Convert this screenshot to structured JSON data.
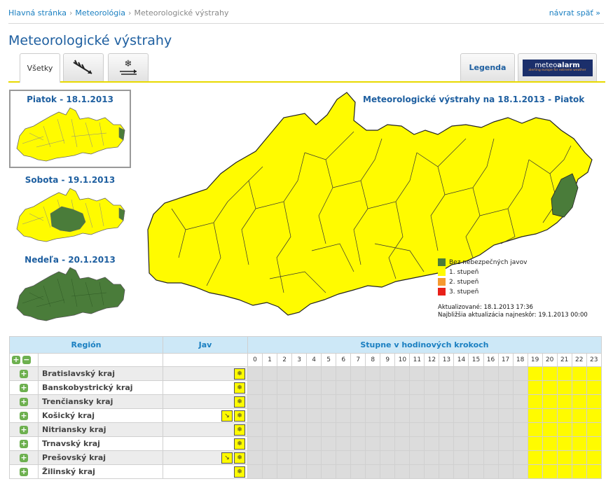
{
  "breadcrumb": {
    "home": "Hlavná stránka",
    "meteo": "Meteorológia",
    "current": "Meteorologické výstrahy"
  },
  "back_link": "návrat späť",
  "page_title": "Meteorologické výstrahy",
  "tabs": {
    "all": "Všetky",
    "legend": "Legenda",
    "meteoalarm_brand": "meteoalarm",
    "meteoalarm_prefix": "meteo",
    "meteoalarm_suffix": "alarm",
    "meteoalarm_tagline": "alerting europe for extreme weather"
  },
  "days": [
    {
      "label": "Piatok - 18.1.2013"
    },
    {
      "label": "Sobota - 19.1.2013"
    },
    {
      "label": "Nedeľa - 20.1.2013"
    }
  ],
  "map_title": "Meteorologické výstrahy na 18.1.2013 - Piatok",
  "legend": [
    {
      "label": "Bez nebezpečných javov",
      "color": "#4a7c3a"
    },
    {
      "label": "1. stupeň",
      "color": "#fffb00"
    },
    {
      "label": "2. stupeň",
      "color": "#f59a30"
    },
    {
      "label": "3. stupeň",
      "color": "#e8201a"
    }
  ],
  "updated": "Aktualizované: 18.1.2013 17:36",
  "next_update": "Najbližšia aktualizácia najneskôr: 19.1.2013 00:00",
  "colors": {
    "accent": "#1e5fa0",
    "yellow": "#fffb00",
    "green": "#4a7c3a"
  },
  "table": {
    "col_region": "Región",
    "col_phen": "Jav",
    "col_hours": "Stupne v hodinových krokoch",
    "hours": [
      "0",
      "1",
      "2",
      "3",
      "4",
      "5",
      "6",
      "7",
      "8",
      "9",
      "10",
      "11",
      "12",
      "13",
      "14",
      "15",
      "16",
      "17",
      "18",
      "19",
      "20",
      "21",
      "22",
      "23"
    ],
    "warn_from_hour": 19,
    "rows": [
      {
        "region": "Bratislavský kraj",
        "icons": [
          "snow-icon"
        ]
      },
      {
        "region": "Banskobystrický kraj",
        "icons": [
          "snow-icon"
        ]
      },
      {
        "region": "Trenčiansky kraj",
        "icons": [
          "snow-icon"
        ]
      },
      {
        "region": "Košický kraj",
        "icons": [
          "wind-icon",
          "snow-icon"
        ]
      },
      {
        "region": "Nitriansky kraj",
        "icons": [
          "snow-icon"
        ]
      },
      {
        "region": "Trnavský kraj",
        "icons": [
          "snow-icon"
        ]
      },
      {
        "region": "Prešovský kraj",
        "icons": [
          "wind-icon",
          "snow-icon"
        ]
      },
      {
        "region": "Žilinský kraj",
        "icons": [
          "snow-icon"
        ]
      }
    ]
  }
}
